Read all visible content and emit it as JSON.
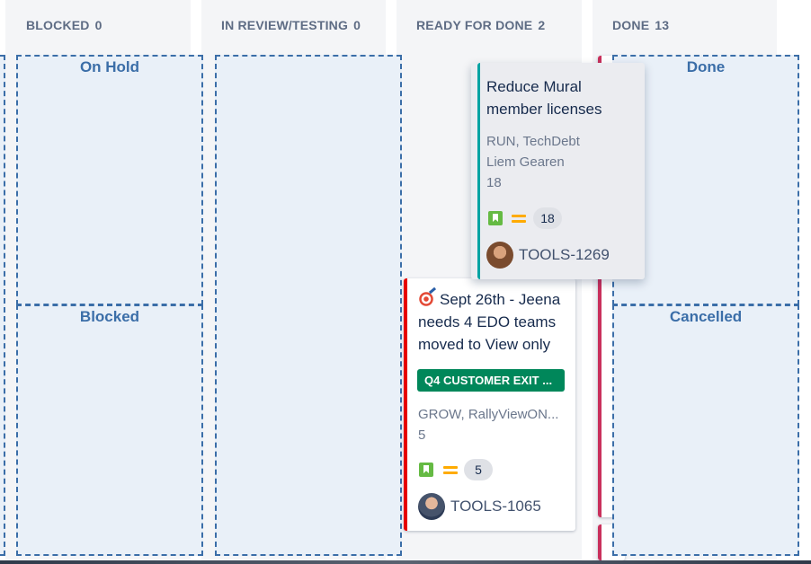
{
  "columns": [
    {
      "name": "BLOCKED",
      "count": "0"
    },
    {
      "name": "IN REVIEW/TESTING",
      "count": "0"
    },
    {
      "name": "READY FOR DONE",
      "count": "2"
    },
    {
      "name": "DONE",
      "count": "13"
    }
  ],
  "drop_zones": {
    "on_hold": "On Hold",
    "blocked": "Blocked",
    "done": "Done",
    "cancelled": "Cancelled"
  },
  "cards": [
    {
      "title": "Reduce Mural member licenses",
      "labels": "RUN, TechDebt",
      "assignee": "Liem Gearen",
      "points": "18",
      "estimate": "18",
      "issue_key": "TOOLS-1269",
      "issue_type_icon": "story-icon",
      "priority_icon": "priority-medium-icon",
      "stripe_color": "#00a3a3"
    },
    {
      "title": "Sept 26th - Jeena needs 4 EDO teams moved to View only",
      "title_icon": "target-icon",
      "epic": "Q4 CUSTOMER EXIT ...",
      "labels": "GROW, RallyViewON...",
      "points": "5",
      "estimate": "5",
      "issue_key": "TOOLS-1065",
      "issue_type_icon": "story-icon",
      "priority_icon": "priority-medium-icon",
      "stripe_color": "#e60000"
    }
  ],
  "colors": {
    "zone_border": "#3b6ea8",
    "zone_bg": "#e9f0f8",
    "epic_green": "#00875a",
    "story_green": "#65ba43",
    "priority_orange": "#ffab00"
  }
}
